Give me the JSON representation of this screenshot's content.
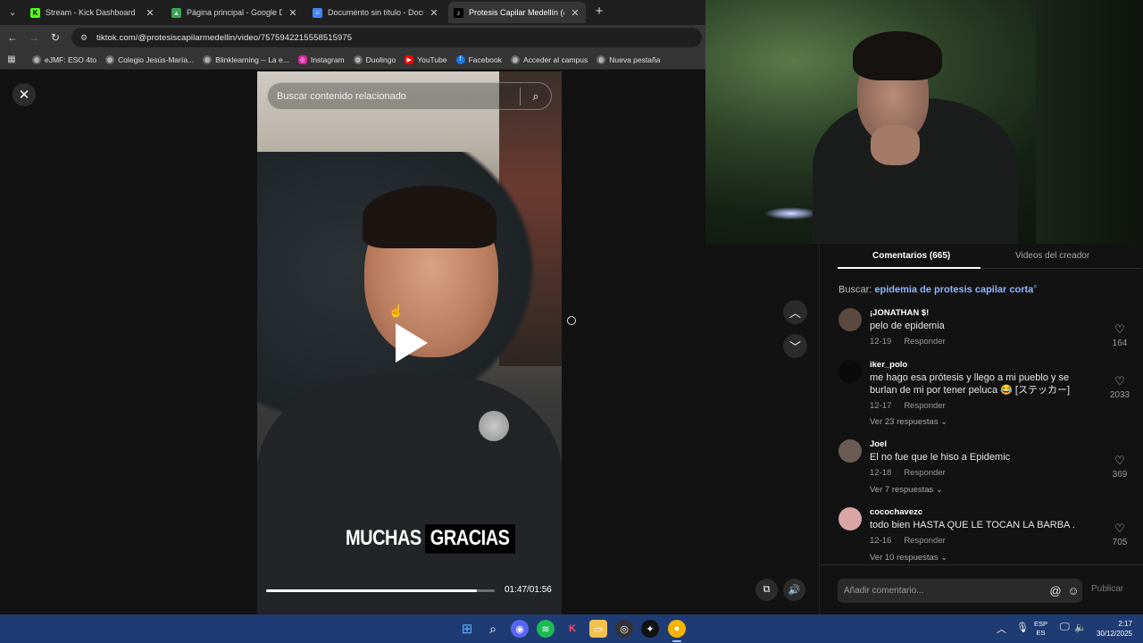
{
  "browser": {
    "tabs": [
      {
        "label": "Stream - Kick Dashboard",
        "favicon": "kick-icon",
        "color": "#53fc18",
        "active": false
      },
      {
        "label": "Página principal - Google Drive",
        "favicon": "drive-icon",
        "color": "#34a853",
        "active": false
      },
      {
        "label": "Documento sin título - Documentos",
        "favicon": "docs-icon",
        "color": "#4285f4",
        "active": false
      },
      {
        "label": "Protesis Capilar Medellín (@protesiscapilarmedellin)",
        "favicon": "tiktok-icon",
        "color": "#ffffff",
        "active": true
      }
    ],
    "url": "tiktok.com/@protesiscapilarmedellin/video/7575942215558515975",
    "bookmarks": [
      {
        "label": "eJMF: ESO 4to",
        "icon": "globe-icon",
        "color": "#6b6b6b"
      },
      {
        "label": "Colegio Jesús-María...",
        "icon": "globe-icon",
        "color": "#6b6b6b"
      },
      {
        "label": "Blinklearning -- La e...",
        "icon": "globe-icon",
        "color": "#6b6b6b"
      },
      {
        "label": "Instagram",
        "icon": "instagram-icon",
        "color": "#d6249f"
      },
      {
        "label": "Duolingo",
        "icon": "globe-icon",
        "color": "#6b6b6b"
      },
      {
        "label": "YouTube",
        "icon": "youtube-icon",
        "color": "#ff0000"
      },
      {
        "label": "Facebook",
        "icon": "facebook-icon",
        "color": "#1877f2"
      },
      {
        "label": "Acceder al campus",
        "icon": "globe-icon",
        "color": "#6b6b6b"
      },
      {
        "label": "Nueva pestaña",
        "icon": "globe-icon",
        "color": "#6b6b6b"
      }
    ]
  },
  "video": {
    "search_placeholder": "Buscar contenido relacionado",
    "caption_plain": "MUCHAS",
    "caption_boxed": "GRACIAS",
    "progress_fraction": 0.92,
    "time": "01:47/01:56"
  },
  "comments_panel": {
    "tab_comments": "Comentarios (665)",
    "tab_creator": "Videos del creador",
    "related_prefix": "Buscar:",
    "related_link": "epidemia de protesis capilar corta",
    "reply_label": "Responder",
    "comments": [
      {
        "user": "¡JONATHAN $!",
        "text": "pelo de epidemia",
        "date": "12-19",
        "likes": "164",
        "replies": "",
        "avatar_color": "#5a4a40"
      },
      {
        "user": "iker_polo",
        "text": "me hago esa prótesis y llego a mi pueblo y se burlan de mi por tener peluca 😂 [ステッカー]",
        "date": "12-17",
        "likes": "2033",
        "replies": "Ver 23 respuestas",
        "avatar_color": "#0a0a0a"
      },
      {
        "user": "Joel",
        "text": "El no fue que le hiso a Epidemic",
        "date": "12-18",
        "likes": "369",
        "replies": "Ver 7 respuestas",
        "avatar_color": "#6b5b55"
      },
      {
        "user": "cocochavezc",
        "text": "todo bien HASTA QUE LE TOCAN LA BARBA .",
        "date": "12-16",
        "likes": "705",
        "replies": "Ver 10 respuestas",
        "avatar_color": "#d9a6a6"
      }
    ],
    "composer_placeholder": "Añadir comentario...",
    "publish_label": "Publicar"
  },
  "taskbar": {
    "lang_top": "ESP",
    "lang_bottom": "ES",
    "time": "2:17",
    "date": "30/12/2025"
  }
}
